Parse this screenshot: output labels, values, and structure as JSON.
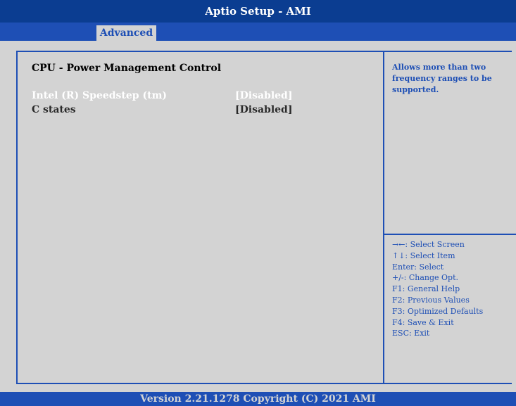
{
  "app": {
    "title": "Aptio Setup - AMI",
    "footer": "Version 2.21.1278 Copyright (C) 2021 AMI"
  },
  "tabs": [
    {
      "label": "Advanced",
      "active": true
    }
  ],
  "main": {
    "section_title": "CPU - Power Management Control",
    "settings": [
      {
        "label": "Intel (R) Speedstep (tm)",
        "value": "[Disabled]",
        "selected": true
      },
      {
        "label": "C states",
        "value": "[Disabled]",
        "selected": false
      }
    ]
  },
  "help": {
    "text": "Allows more than two frequency ranges to be supported."
  },
  "keys": [
    "→←: Select Screen",
    "↑↓: Select Item",
    "Enter: Select",
    "+/-: Change Opt.",
    "F1: General Help",
    "F2: Previous Values",
    "F3: Optimized Defaults",
    "F4: Save & Exit",
    "ESC: Exit"
  ],
  "colors": {
    "title_bar": "#0b3d91",
    "accent_blue": "#1e4fb5",
    "background": "#d3d3d3",
    "selected_text": "#ffffff"
  }
}
